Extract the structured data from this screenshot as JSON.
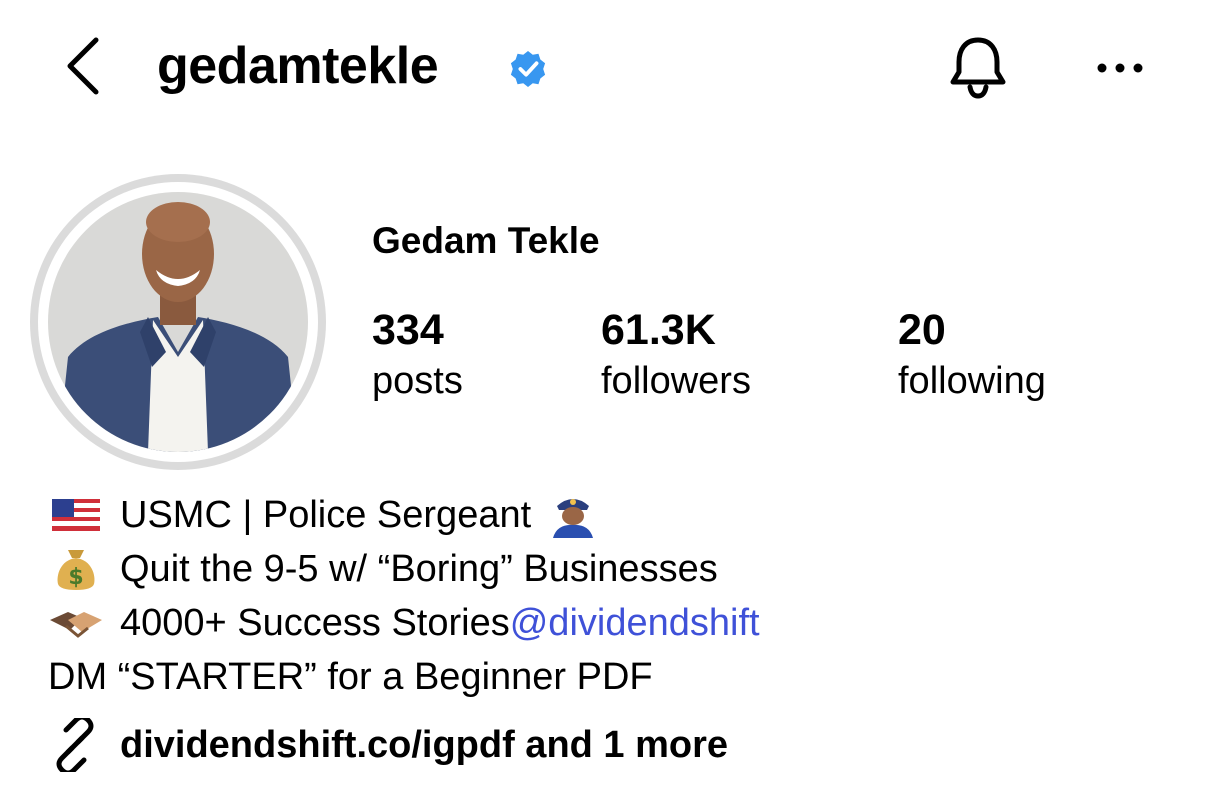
{
  "header": {
    "username": "gedamtekle",
    "back_icon": "chevron-left-icon",
    "verified_icon": "verified-badge-icon",
    "bell_icon": "bell-icon",
    "more_icon": "more-horizontal-icon",
    "accent_color": "#3897f0"
  },
  "profile": {
    "display_name": "Gedam Tekle",
    "stats": [
      {
        "value": "334",
        "label": "posts"
      },
      {
        "value": "61.3K",
        "label": "followers"
      },
      {
        "value": "20",
        "label": "following"
      }
    ]
  },
  "bio": {
    "lines": [
      {
        "icon": "us-flag-icon",
        "text": "USMC | Police Sergeant",
        "trailing_icon": "police-officer-icon"
      },
      {
        "icon": "money-bag-icon",
        "text": "Quit the 9-5 w/ “Boring” Businesses"
      },
      {
        "icon": "handshake-icon",
        "text": "4000+ Success Stories ",
        "mention": "@dividendshift"
      },
      {
        "text": "DM “STARTER” for a Beginner PDF"
      }
    ],
    "mention_color": "#3f51d8"
  },
  "link": {
    "icon": "link-icon",
    "text": "dividendshift.co/igpdf and 1 more"
  }
}
